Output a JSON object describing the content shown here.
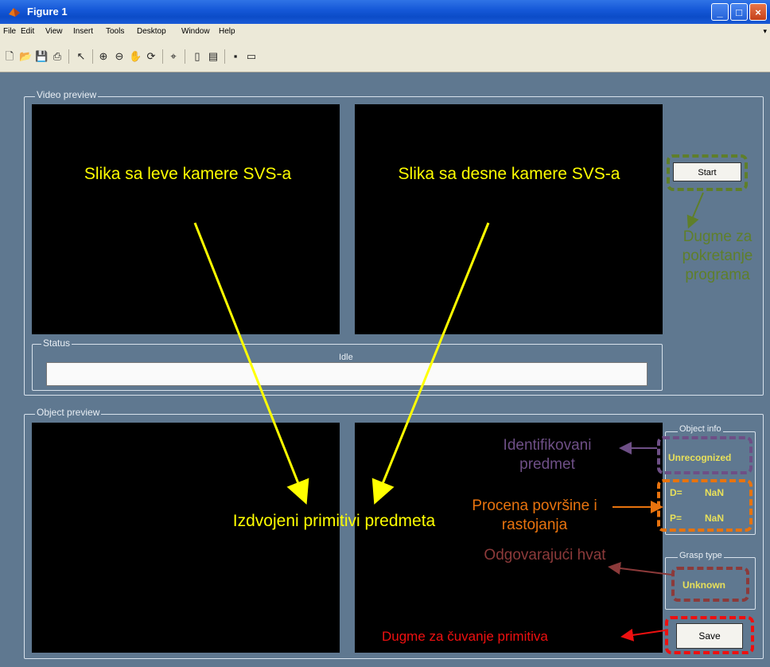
{
  "window": {
    "title": "Figure 1",
    "controls": [
      "_",
      "□",
      "×"
    ]
  },
  "menu": [
    "File",
    "Edit",
    "View",
    "Insert",
    "Tools",
    "Desktop",
    "Window",
    "Help"
  ],
  "toolbar_icons": [
    "new-icon",
    "open-icon",
    "save-icon",
    "print-icon",
    "pointer-icon",
    "zoom-in-icon",
    "zoom-out-icon",
    "pan-icon",
    "rotate-icon",
    "data-cursor-icon",
    "colorbar-icon",
    "legend-icon",
    "hide-plot-tools-icon",
    "show-plot-tools-icon"
  ],
  "video_panel": {
    "title": "Video preview",
    "start_label": "Start"
  },
  "status_panel": {
    "title": "Status",
    "text": "Idle"
  },
  "object_panel": {
    "title": "Object preview",
    "object_info_title": "Object info",
    "object_value": "Unrecognized",
    "d_label": "D=",
    "d_value": "NaN",
    "p_label": "P=",
    "p_value": "NaN",
    "grasp_title": "Grasp type",
    "grasp_value": "Unknown",
    "save_label": "Save"
  },
  "annotations": {
    "left_camera": "Slika sa leve kamere SVS-a",
    "right_camera": "Slika sa desne kamere SVS-a",
    "start_button": "Dugme za pokretanje programa",
    "identified": "Identifikovani predmet",
    "area_distance": "Procena površine i rastojanja",
    "grasp": "Odgovarajući hvat",
    "primitives": "Izdvojeni primitivi predmeta",
    "save_button": "Dugme za čuvanje primitiva"
  },
  "colors": {
    "background": "#5f7890",
    "annotation_yellow": "#ffff00",
    "annotation_green": "#5f7f2a",
    "annotation_purple": "#6e4f86",
    "annotation_orange": "#e8730e",
    "annotation_brown": "#8c3a3a",
    "annotation_red": "#ee1010"
  }
}
